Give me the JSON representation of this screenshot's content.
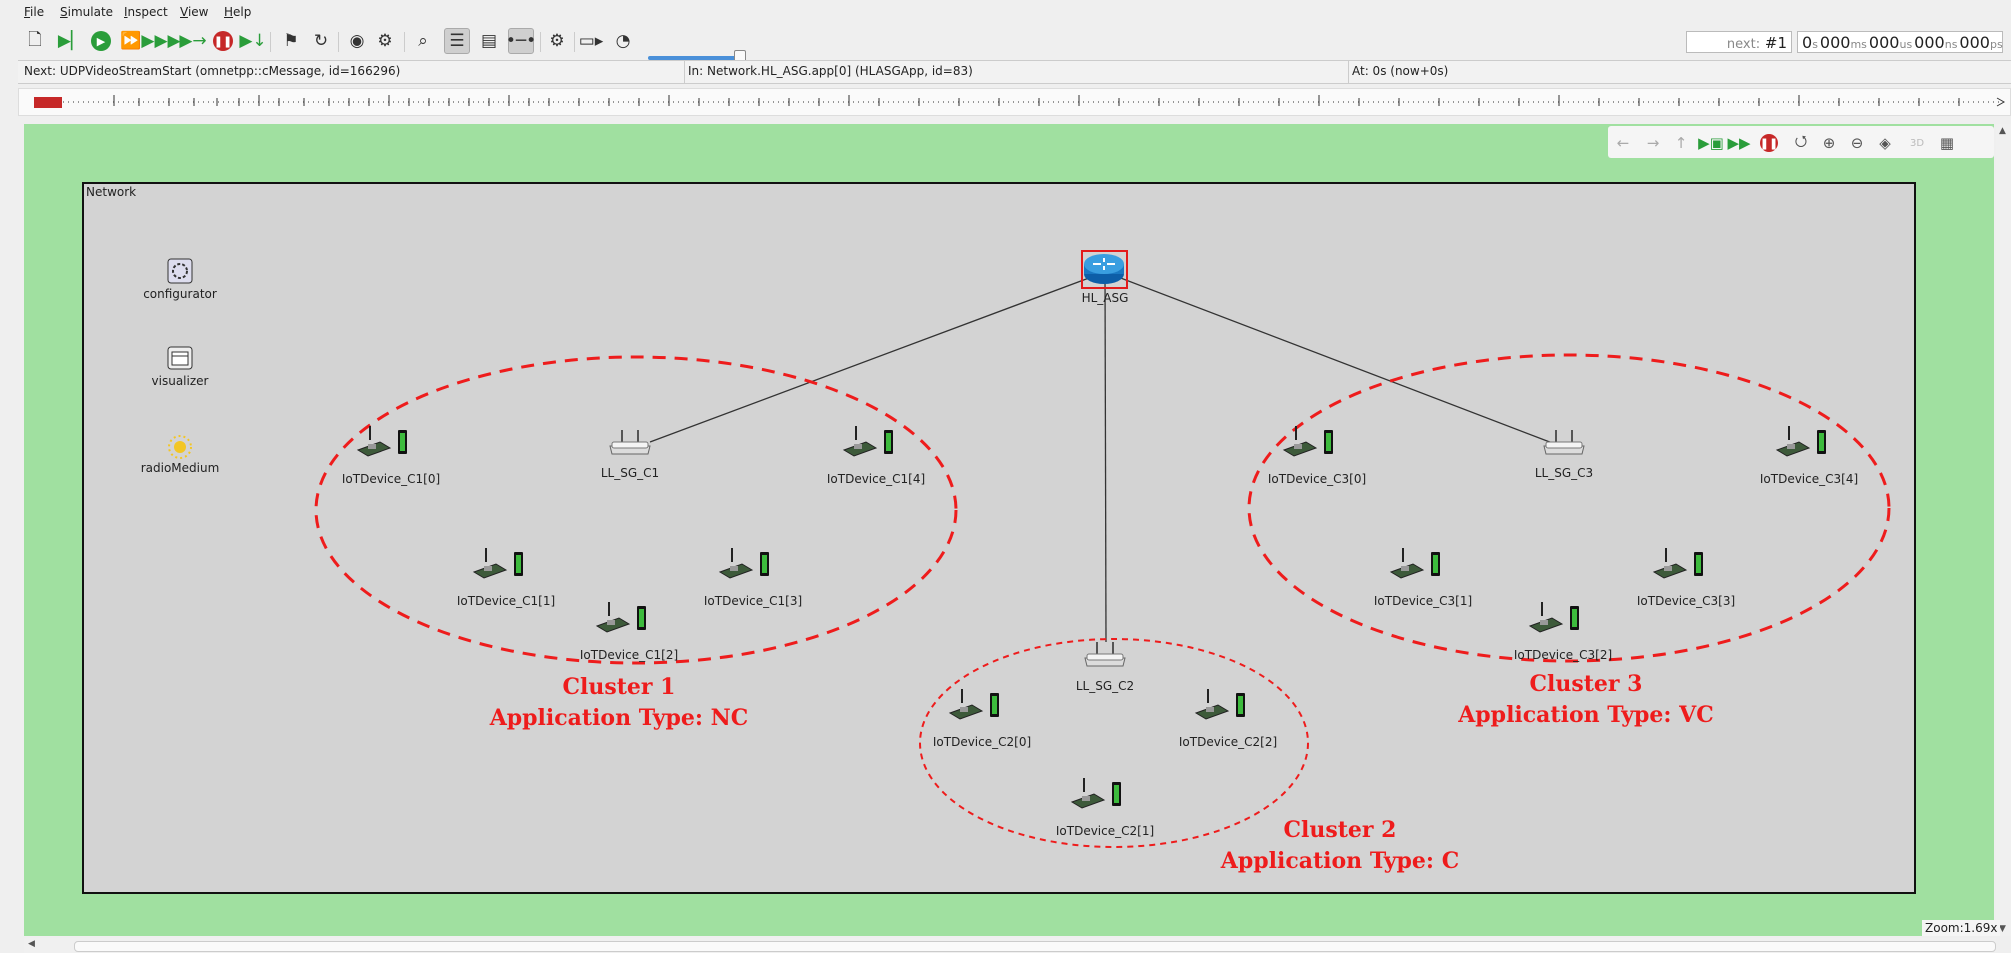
{
  "menu": {
    "items": [
      "File",
      "Simulate",
      "Inspect",
      "View",
      "Help"
    ]
  },
  "toolbar": {
    "icons": [
      "new-network-icon",
      "step-icon",
      "run-icon",
      "fast-run-icon",
      "express-run-icon",
      "run-until-icon",
      "stop-icon",
      "step-back-icon",
      "finish-icon",
      "rebuild-icon",
      "record-icon",
      "debug-icon",
      "find-icon",
      "timeline-toggle-icon",
      "layout-icon",
      "inspector-icon",
      "settings-icon",
      "video-icon",
      "speed-icon"
    ],
    "next_label": "next:",
    "next_value": "#1",
    "time": {
      "s": "0",
      "ms": "000",
      "us": "000",
      "ns": "000",
      "ps": "000"
    },
    "speed_fraction": 0.9
  },
  "status": {
    "next": "Next: UDPVideoStreamStart (omnetpp::cMessage, id=166296)",
    "in": "In: Network.HL_ASG.app[0] (HLASGApp, id=83)",
    "at": "At: 0s (now+0s)"
  },
  "network": {
    "label": "Network",
    "modules": [
      {
        "id": "configurator",
        "label": "configurator",
        "icon": "gear-icon"
      },
      {
        "id": "visualizer",
        "label": "visualizer",
        "icon": "window-icon"
      },
      {
        "id": "radioMedium",
        "label": "radioMedium",
        "icon": "sun-icon"
      }
    ],
    "routers": [
      {
        "id": "hl-asg",
        "label": "HL_ASG",
        "icon": "router-icon"
      }
    ],
    "gateways": [
      {
        "id": "ll-sg-c1",
        "label": "LL_SG_C1",
        "icon": "access-point-icon"
      },
      {
        "id": "ll-sg-c2",
        "label": "LL_SG_C2",
        "icon": "access-point-icon"
      },
      {
        "id": "ll-sg-c3",
        "label": "LL_SG_C3",
        "icon": "access-point-icon"
      }
    ],
    "devices": [
      {
        "id": "c1-0",
        "label": "IoTDevice_C1[0]"
      },
      {
        "id": "c1-1",
        "label": "IoTDevice_C1[1]"
      },
      {
        "id": "c1-2",
        "label": "IoTDevice_C1[2]"
      },
      {
        "id": "c1-3",
        "label": "IoTDevice_C1[3]"
      },
      {
        "id": "c1-4",
        "label": "IoTDevice_C1[4]"
      },
      {
        "id": "c2-0",
        "label": "IoTDevice_C2[0]"
      },
      {
        "id": "c2-1",
        "label": "IoTDevice_C2[1]"
      },
      {
        "id": "c2-2",
        "label": "IoTDevice_C2[2]"
      },
      {
        "id": "c3-0",
        "label": "IoTDevice_C3[0]"
      },
      {
        "id": "c3-1",
        "label": "IoTDevice_C3[1]"
      },
      {
        "id": "c3-2",
        "label": "IoTDevice_C3[2]"
      },
      {
        "id": "c3-3",
        "label": "IoTDevice_C3[3]"
      },
      {
        "id": "c3-4",
        "label": "IoTDevice_C3[4]"
      }
    ],
    "clusters": [
      {
        "id": "cluster-1",
        "title": "Cluster 1",
        "subtitle": "Application Type: NC"
      },
      {
        "id": "cluster-2",
        "title": "Cluster 2",
        "subtitle": "Application Type: C"
      },
      {
        "id": "cluster-3",
        "title": "Cluster 3",
        "subtitle": "Application Type: VC"
      }
    ],
    "accent_color": "#ee1c1c"
  },
  "canvas": {
    "background": "#a0e0a0",
    "zoom": "Zoom:1.69x"
  }
}
